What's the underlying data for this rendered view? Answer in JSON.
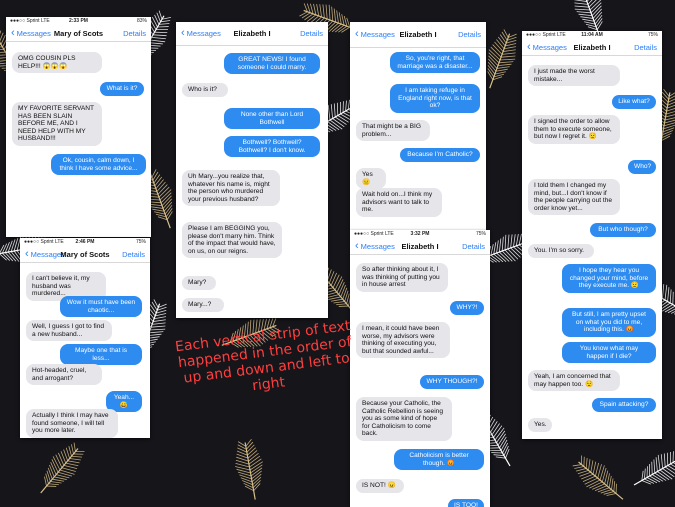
{
  "background": {
    "color": "#15151a",
    "feathers": [
      "#ffffff",
      "#d9c08a"
    ]
  },
  "caption": "Each vertical strip of text happened in the order of up and down and left to right",
  "shots": [
    {
      "status": {
        "carrier": "●●●○○ Sprint  LTE",
        "time": "2:33 PM",
        "battery": "83%"
      },
      "nav": {
        "back": "Messages",
        "title": "Mary of Scots",
        "details": "Details"
      },
      "messages": [
        {
          "from": "in",
          "text": "OMG COUSIN PLS HELP!!! 😱😱😱"
        },
        {
          "from": "out",
          "text": "What is it?"
        },
        {
          "from": "in",
          "text": "MY FAVORITE SERVANT HAS BEEN SLAIN BEFORE ME, AND I NEED HELP WITH MY HUSBAND!!!"
        },
        {
          "from": "out",
          "text": "Ok, cousin, calm down, I think I have some advice..."
        }
      ]
    },
    {
      "status": {
        "carrier": "●●●○○ Sprint  LTE",
        "time": "2:46 PM",
        "battery": "75%"
      },
      "nav": {
        "back": "Messages",
        "title": "Mary of Scots",
        "details": "Details"
      },
      "messages": [
        {
          "from": "in",
          "text": "I can't believe it, my husband was murdered..."
        },
        {
          "from": "out",
          "text": "Wow it must have been chaotic..."
        },
        {
          "from": "in",
          "text": "Well, I guess I got to find a new husband..."
        },
        {
          "from": "out",
          "text": "Maybe one that is less..."
        },
        {
          "from": "in",
          "text": "Hot-headed, cruel, and arrogant?"
        },
        {
          "from": "out",
          "text": "Yeah... 😅"
        },
        {
          "from": "in",
          "text": "Actually I think I may have found someone, I will tell you more later."
        }
      ]
    },
    {
      "status": {
        "carrier": "",
        "time": "",
        "battery": ""
      },
      "nav": {
        "back": "Messages",
        "title": "Elizabeth I",
        "details": "Details"
      },
      "messages": [
        {
          "from": "out",
          "text": "GREAT NEWS! I found someone I could marry."
        },
        {
          "from": "in",
          "text": "Who is it?"
        },
        {
          "from": "out",
          "text": "None other than Lord Bothwell"
        },
        {
          "from": "out",
          "text": "Bothwell? Bothwell? Bothwell? I don't know."
        },
        {
          "from": "in",
          "text": "Uh Mary...you realize that, whatever his name is, might the person who murdered your previous husband?"
        },
        {
          "from": "in",
          "text": "Please I am BEGGING you, please don't marry him. Think of the impact that would have, on us, on our reigns."
        },
        {
          "from": "in",
          "text": "Mary?"
        },
        {
          "from": "in",
          "text": "Mary...?"
        }
      ]
    },
    {
      "status": {
        "carrier": "",
        "time": "",
        "battery": ""
      },
      "nav": {
        "back": "Messages",
        "title": "Elizabeth I",
        "details": "Details"
      },
      "messages": [
        {
          "from": "out",
          "text": "So, you're right, that marriage was a disaster..."
        },
        {
          "from": "out",
          "text": "I am taking refuge in England right now, is that ok?"
        },
        {
          "from": "in",
          "text": "That might be a BIG problem..."
        },
        {
          "from": "out",
          "text": "Because I'm Catholic?"
        },
        {
          "from": "in",
          "text": "Yes 😐"
        },
        {
          "from": "in",
          "text": "Wait hold on...I think my advisors want to talk to me."
        }
      ]
    },
    {
      "status": {
        "carrier": "●●●○○ Sprint  LTE",
        "time": "3:32 PM",
        "battery": "75%"
      },
      "nav": {
        "back": "Messages",
        "title": "Elizabeth I",
        "details": "Details"
      },
      "messages": [
        {
          "from": "in",
          "text": "So after thinking about it, I was thinking of putting you in house arrest"
        },
        {
          "from": "out",
          "text": "WHY?!"
        },
        {
          "from": "in",
          "text": "I mean, it could have been worse, my advisors were thinking of executing you, but that sounded awful..."
        },
        {
          "from": "out",
          "text": "WHY THOUGH?!"
        },
        {
          "from": "in",
          "text": "Because your Catholic, the Catholic Rebellion is seeing you as some kind of hope for Catholicism to come back."
        },
        {
          "from": "out",
          "text": "Catholicism is better though. 😡"
        },
        {
          "from": "in",
          "text": "IS NOT! 😠"
        },
        {
          "from": "out",
          "text": "IS TOO!"
        }
      ]
    },
    {
      "status": {
        "carrier": "●●●○○ Sprint  LTE",
        "time": "11:04 AM",
        "battery": "75%"
      },
      "nav": {
        "back": "Messages",
        "title": "Elizabeth I",
        "details": "Details"
      },
      "messages": [
        {
          "from": "in",
          "text": "I just made the worst mistake..."
        },
        {
          "from": "out",
          "text": "Like what?"
        },
        {
          "from": "in",
          "text": "I signed the order to allow them to execute someone, but now I regret it. 😟"
        },
        {
          "from": "out",
          "text": "Who?"
        },
        {
          "from": "in",
          "text": "I told them I changed my mind, but...I don't know if the people carrying out the order know yet..."
        },
        {
          "from": "out",
          "text": "But who though?"
        },
        {
          "from": "in",
          "text": "You. I'm so sorry."
        },
        {
          "from": "out",
          "text": "I hope they hear you changed your mind, before they execute me. 😟"
        },
        {
          "from": "out",
          "text": "But still, I am pretty upset on what you did to me, including this. 😡"
        },
        {
          "from": "out",
          "text": "You know what may happen if I die?"
        },
        {
          "from": "in",
          "text": "Yeah, I am concerned that may happen too. 😟"
        },
        {
          "from": "out",
          "text": "Spain attacking?"
        },
        {
          "from": "in",
          "text": "Yes."
        }
      ]
    }
  ]
}
